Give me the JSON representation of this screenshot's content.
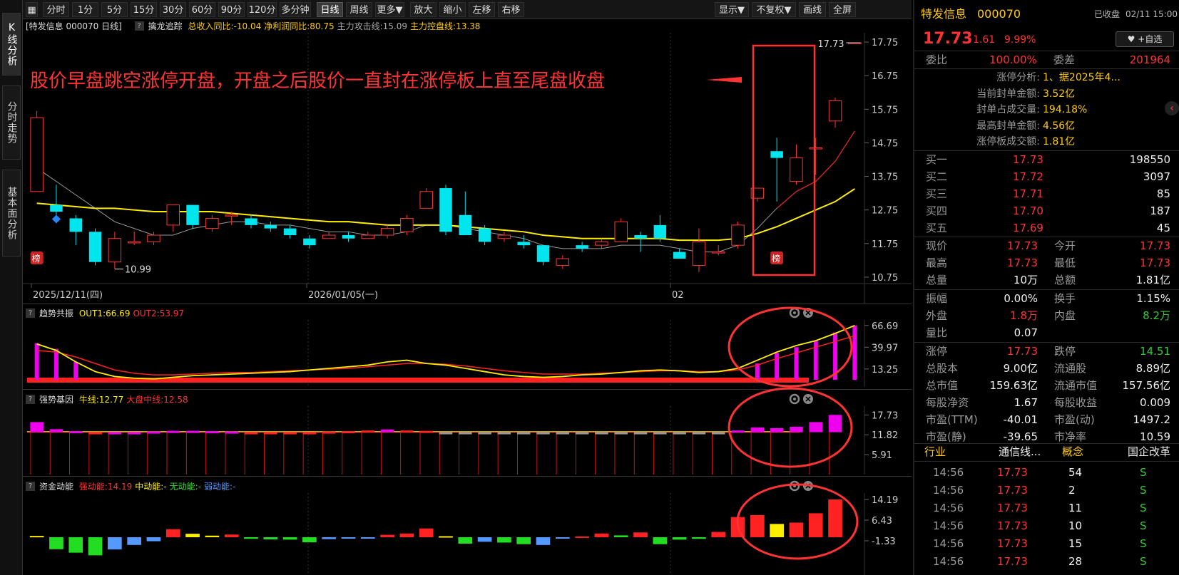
{
  "left_tabs": [
    "K线分析",
    "分时走势",
    "基本面分析"
  ],
  "toolbar": {
    "periods": [
      "分时",
      "1分",
      "5分",
      "15分",
      "30分",
      "60分",
      "90分",
      "120分",
      "多分钟",
      "日线",
      "周线",
      "更多▼",
      "放大",
      "缩小",
      "左移",
      "右移"
    ],
    "active_period": "日线",
    "right_buttons": [
      "显示▼",
      "不复权▼",
      "画线",
      "全屏"
    ]
  },
  "main_panel": {
    "header_title": "[特发信息 000070 日线]",
    "indicator_name": "擒龙追踪",
    "metrics": [
      {
        "label": "总收入同比:",
        "value": "-10.04",
        "color": "#ffcc00"
      },
      {
        "label": "净利润同比:",
        "value": "80.75",
        "color": "#ffcc00"
      },
      {
        "label": "主力攻击线:",
        "value": "15.09",
        "color": "#aaaaaa"
      },
      {
        "label": "主力控盘线:",
        "value": "13.38",
        "color": "#ffcc00"
      }
    ],
    "annotation": "股价早盘跳空涨停开盘，开盘之后股价一直封在涨停板上直至尾盘收盘",
    "y_ticks": [
      "17.75",
      "16.75",
      "15.75",
      "14.75",
      "13.75",
      "12.75",
      "11.75",
      "10.75"
    ],
    "high_label": "17.73",
    "low_label": "10.99",
    "rank_badge": "榜",
    "dates": [
      "2025/12/11(四)",
      "2026/01/05(一)",
      "02"
    ]
  },
  "panels": [
    {
      "name": "趋势共振",
      "metrics": [
        {
          "label": "OUT1:",
          "value": "66.69",
          "color": "#ffee00"
        },
        {
          "label": "OUT2:",
          "value": "53.97",
          "color": "#ff3333"
        }
      ],
      "y_ticks": [
        "66.69",
        "39.97",
        "13.25"
      ]
    },
    {
      "name": "强势基因",
      "metrics": [
        {
          "label": "牛线:",
          "value": "12.77",
          "color": "#ffee00"
        },
        {
          "label": "大盘中线:",
          "value": "12.58",
          "color": "#ff3333"
        }
      ],
      "y_ticks": [
        "17.73",
        "11.82",
        "5.91"
      ]
    },
    {
      "name": "资金动能",
      "metrics": [
        {
          "label": "强动能:",
          "value": "14.19",
          "color": "#ff3333"
        },
        {
          "label": "中动能:",
          "value": "-",
          "color": "#ffee00"
        },
        {
          "label": "无动能:",
          "value": "-",
          "color": "#33dd33"
        },
        {
          "label": "弱动能:",
          "value": "-",
          "color": "#5599ff"
        }
      ],
      "y_ticks": [
        "14.19",
        "6.43",
        "-1.33"
      ]
    }
  ],
  "chart_data": {
    "type": "candlestick",
    "y_range": [
      10.6,
      17.9
    ],
    "candles": [
      {
        "o": 13.3,
        "c": 15.5,
        "h": 15.7,
        "l": 13.3
      },
      {
        "o": 12.9,
        "c": 12.7,
        "h": 13.5,
        "l": 12.6
      },
      {
        "o": 12.5,
        "c": 12.1,
        "h": 12.6,
        "l": 11.7
      },
      {
        "o": 12.1,
        "c": 11.2,
        "h": 12.2,
        "l": 11.1
      },
      {
        "o": 11.2,
        "c": 11.9,
        "h": 12.1,
        "l": 10.99
      },
      {
        "o": 11.8,
        "c": 11.8,
        "h": 12.1,
        "l": 11.7
      },
      {
        "o": 11.8,
        "c": 12.0,
        "h": 12.1,
        "l": 11.7
      },
      {
        "o": 12.3,
        "c": 12.9,
        "h": 12.9,
        "l": 12.1
      },
      {
        "o": 12.9,
        "c": 12.3,
        "h": 12.9,
        "l": 12.2
      },
      {
        "o": 12.2,
        "c": 12.5,
        "h": 12.6,
        "l": 12.1
      },
      {
        "o": 12.6,
        "c": 12.6,
        "h": 12.7,
        "l": 12.3
      },
      {
        "o": 12.5,
        "c": 12.3,
        "h": 12.6,
        "l": 12.2
      },
      {
        "o": 12.3,
        "c": 12.2,
        "h": 12.4,
        "l": 12.1
      },
      {
        "o": 12.2,
        "c": 12.0,
        "h": 12.3,
        "l": 11.9
      },
      {
        "o": 11.9,
        "c": 11.7,
        "h": 12.0,
        "l": 11.6
      },
      {
        "o": 11.9,
        "c": 12.0,
        "h": 12.1,
        "l": 11.9
      },
      {
        "o": 12.0,
        "c": 11.9,
        "h": 12.1,
        "l": 11.8
      },
      {
        "o": 11.9,
        "c": 12.0,
        "h": 12.1,
        "l": 11.9
      },
      {
        "o": 12.0,
        "c": 12.2,
        "h": 12.3,
        "l": 11.9
      },
      {
        "o": 12.1,
        "c": 12.5,
        "h": 12.6,
        "l": 12.0
      },
      {
        "o": 12.8,
        "c": 13.3,
        "h": 13.4,
        "l": 12.8
      },
      {
        "o": 13.4,
        "c": 12.1,
        "h": 13.5,
        "l": 12.0
      },
      {
        "o": 12.6,
        "c": 12.0,
        "h": 13.3,
        "l": 12.0
      },
      {
        "o": 12.2,
        "c": 11.8,
        "h": 12.3,
        "l": 11.7
      },
      {
        "o": 11.9,
        "c": 12.0,
        "h": 12.1,
        "l": 11.8
      },
      {
        "o": 11.8,
        "c": 11.7,
        "h": 12.0,
        "l": 11.6
      },
      {
        "o": 11.7,
        "c": 11.2,
        "h": 11.7,
        "l": 11.1
      },
      {
        "o": 11.1,
        "c": 11.3,
        "h": 11.4,
        "l": 11.0
      },
      {
        "o": 11.7,
        "c": 11.6,
        "h": 11.8,
        "l": 11.5
      },
      {
        "o": 11.7,
        "c": 11.8,
        "h": 11.9,
        "l": 11.6
      },
      {
        "o": 11.8,
        "c": 12.4,
        "h": 12.5,
        "l": 11.8
      },
      {
        "o": 12.0,
        "c": 11.9,
        "h": 12.1,
        "l": 11.5
      },
      {
        "o": 12.3,
        "c": 11.9,
        "h": 12.6,
        "l": 11.8
      },
      {
        "o": 11.5,
        "c": 11.3,
        "h": 11.6,
        "l": 11.3
      },
      {
        "o": 11.1,
        "c": 11.8,
        "h": 12.2,
        "l": 10.9
      },
      {
        "o": 11.5,
        "c": 11.5,
        "h": 11.7,
        "l": 11.4
      },
      {
        "o": 11.7,
        "c": 12.3,
        "h": 12.4,
        "l": 11.6
      },
      {
        "o": 13.1,
        "c": 13.4,
        "h": 13.4,
        "l": 13.0
      },
      {
        "o": 14.5,
        "c": 14.3,
        "h": 14.9,
        "l": 13.0
      },
      {
        "o": 13.6,
        "c": 14.3,
        "h": 14.7,
        "l": 13.5
      },
      {
        "o": 14.6,
        "c": 14.6,
        "h": 14.9,
        "l": 13.8
      },
      {
        "o": 15.4,
        "c": 16.0,
        "h": 16.1,
        "l": 15.2
      },
      {
        "o": 17.73,
        "c": 17.73,
        "h": 17.73,
        "l": 17.73
      }
    ],
    "ma_gray": [
      14.0,
      13.6,
      13.2,
      12.8,
      12.4,
      12.2,
      12.0,
      12.0,
      12.2,
      12.3,
      12.4,
      12.4,
      12.3,
      12.3,
      12.2,
      12.1,
      12.1,
      12.0,
      12.0,
      12.1,
      12.3,
      12.3,
      12.2,
      12.1,
      12.0,
      11.9,
      11.7,
      11.6,
      11.6,
      11.6,
      11.7,
      11.7,
      11.7,
      11.6,
      11.5,
      11.5,
      11.7,
      12.2,
      12.8,
      13.3,
      13.6,
      14.2,
      15.1
    ],
    "ma_yellow": [
      12.95,
      12.9,
      12.85,
      12.8,
      12.8,
      12.75,
      12.7,
      12.7,
      12.7,
      12.7,
      12.65,
      12.6,
      12.55,
      12.5,
      12.45,
      12.4,
      12.4,
      12.35,
      12.3,
      12.3,
      12.3,
      12.3,
      12.25,
      12.2,
      12.15,
      12.1,
      12.0,
      11.95,
      11.9,
      11.9,
      11.9,
      11.9,
      11.9,
      11.85,
      11.85,
      11.85,
      11.9,
      12.05,
      12.25,
      12.5,
      12.75,
      13.0,
      13.38
    ],
    "trend_bars": [
      45,
      38,
      22,
      0,
      0,
      0,
      0,
      0,
      0,
      0,
      0,
      0,
      0,
      0,
      0,
      0,
      0,
      0,
      0,
      0,
      0,
      0,
      0,
      0,
      0,
      0,
      0,
      0,
      0,
      0,
      0,
      0,
      0,
      0,
      0,
      0,
      0,
      20,
      33,
      40,
      48,
      58,
      66.69
    ],
    "trend_out1": [
      44,
      36,
      22,
      10,
      4,
      2,
      1,
      3,
      5,
      6,
      7,
      8,
      9,
      10,
      12,
      14,
      16,
      18,
      22,
      24,
      20,
      18,
      14,
      10,
      6,
      4,
      3,
      4,
      6,
      7,
      9,
      11,
      12,
      11,
      9,
      10,
      14,
      24,
      34,
      42,
      48,
      57,
      66.69
    ],
    "trend_out2": [
      36,
      34,
      28,
      20,
      12,
      8,
      6,
      6,
      7,
      8,
      9,
      9,
      10,
      11,
      12,
      13,
      14,
      16,
      18,
      20,
      20,
      19,
      17,
      14,
      11,
      9,
      7,
      7,
      7,
      8,
      9,
      10,
      11,
      11,
      10,
      10,
      12,
      18,
      26,
      33,
      40,
      47,
      53.97
    ],
    "gene_bars": [
      {
        "v": 15.6,
        "c": "#ee00ee"
      },
      {
        "v": 13.5,
        "c": "#ee00ee"
      },
      {
        "v": 12.9,
        "c": "#ee00ee"
      },
      {
        "v": 12.3,
        "c": "#ff2222"
      },
      {
        "v": 12.4,
        "c": "#ee00ee"
      },
      {
        "v": 12.6,
        "c": "#ee00ee"
      },
      {
        "v": 12.8,
        "c": "#ee00ee"
      },
      {
        "v": 13.0,
        "c": "#ee00ee"
      },
      {
        "v": 13.0,
        "c": "#ee00ee"
      },
      {
        "v": 12.9,
        "c": "#ee00ee"
      },
      {
        "v": 12.8,
        "c": "#ee00ee"
      },
      {
        "v": 12.6,
        "c": "#ff2222"
      },
      {
        "v": 12.5,
        "c": "#ff2222"
      },
      {
        "v": 12.4,
        "c": "#ff2222"
      },
      {
        "v": 12.6,
        "c": "#ff2222"
      },
      {
        "v": 12.8,
        "c": "#ff2222"
      },
      {
        "v": 12.9,
        "c": "#ff2222"
      },
      {
        "v": 13.1,
        "c": "#ff2222"
      },
      {
        "v": 13.4,
        "c": "#ee00ee"
      },
      {
        "v": 13.1,
        "c": "#ff2222"
      },
      {
        "v": 13.0,
        "c": "#ff2222"
      },
      {
        "v": 12.5,
        "c": "#999999"
      },
      {
        "v": 12.4,
        "c": "#999999"
      },
      {
        "v": 12.3,
        "c": "#999999"
      },
      {
        "v": 12.3,
        "c": "#999999"
      },
      {
        "v": 12.2,
        "c": "#999999"
      },
      {
        "v": 12.2,
        "c": "#999999"
      },
      {
        "v": 12.1,
        "c": "#999999"
      },
      {
        "v": 12.2,
        "c": "#999999"
      },
      {
        "v": 12.3,
        "c": "#999999"
      },
      {
        "v": 12.3,
        "c": "#999999"
      },
      {
        "v": 12.2,
        "c": "#999999"
      },
      {
        "v": 12.1,
        "c": "#999999"
      },
      {
        "v": 12.2,
        "c": "#999999"
      },
      {
        "v": 12.3,
        "c": "#999999"
      },
      {
        "v": 12.4,
        "c": "#999999"
      },
      {
        "v": 13.1,
        "c": "#ee00ee"
      },
      {
        "v": 14.0,
        "c": "#ee00ee"
      },
      {
        "v": 13.8,
        "c": "#ee00ee"
      },
      {
        "v": 14.2,
        "c": "#ee00ee"
      },
      {
        "v": 15.6,
        "c": "#ee00ee"
      },
      {
        "v": 17.73,
        "c": "#ee00ee"
      }
    ],
    "fund_bars": [
      {
        "v": 0.5,
        "c": "#ffee00"
      },
      {
        "v": -4.5,
        "c": "#22dd22"
      },
      {
        "v": -5.8,
        "c": "#22dd22"
      },
      {
        "v": -6.8,
        "c": "#22dd22"
      },
      {
        "v": -4.6,
        "c": "#5599ff"
      },
      {
        "v": -2.9,
        "c": "#5599ff"
      },
      {
        "v": -1.5,
        "c": "#5599ff"
      },
      {
        "v": 3.0,
        "c": "#ff2222"
      },
      {
        "v": 1.3,
        "c": "#ffee00"
      },
      {
        "v": 0.6,
        "c": "#ffee00"
      },
      {
        "v": 1.0,
        "c": "#ff2222"
      },
      {
        "v": -0.6,
        "c": "#22dd22"
      },
      {
        "v": -0.8,
        "c": "#22dd22"
      },
      {
        "v": -0.9,
        "c": "#22dd22"
      },
      {
        "v": -1.9,
        "c": "#22dd22"
      },
      {
        "v": -0.7,
        "c": "#5599ff"
      },
      {
        "v": -0.5,
        "c": "#5599ff"
      },
      {
        "v": -0.4,
        "c": "#5599ff"
      },
      {
        "v": 0.9,
        "c": "#ff2222"
      },
      {
        "v": 1.4,
        "c": "#ff2222"
      },
      {
        "v": 3.3,
        "c": "#ff2222"
      },
      {
        "v": 0.4,
        "c": "#ffee00"
      },
      {
        "v": -2.4,
        "c": "#22dd22"
      },
      {
        "v": -1.7,
        "c": "#5599ff"
      },
      {
        "v": -2.0,
        "c": "#22dd22"
      },
      {
        "v": -2.6,
        "c": "#22dd22"
      },
      {
        "v": -2.9,
        "c": "#5599ff"
      },
      {
        "v": -0.4,
        "c": "#5599ff"
      },
      {
        "v": 0.3,
        "c": "#ff2222"
      },
      {
        "v": 1.4,
        "c": "#ff2222"
      },
      {
        "v": 0.7,
        "c": "#22dd22"
      },
      {
        "v": 1.8,
        "c": "#ff2222"
      },
      {
        "v": -2.6,
        "c": "#22dd22"
      },
      {
        "v": -0.9,
        "c": "#22dd22"
      },
      {
        "v": -0.6,
        "c": "#22dd22"
      },
      {
        "v": 2.0,
        "c": "#ff2222"
      },
      {
        "v": 7.6,
        "c": "#ff2222"
      },
      {
        "v": 8.3,
        "c": "#ff2222"
      },
      {
        "v": 5.0,
        "c": "#ffee00"
      },
      {
        "v": 5.5,
        "c": "#ff2222"
      },
      {
        "v": 9.0,
        "c": "#ff2222"
      },
      {
        "v": 14.19,
        "c": "#ff2222"
      }
    ]
  },
  "quote": {
    "name": "特发信息",
    "code": "000070",
    "status": "已收盘",
    "datetime": "02/11 15:00",
    "price": "17.73",
    "change": "1.61",
    "change_pct": "9.99%",
    "watch_button": "+自选",
    "weibi_label": "委比",
    "weibi": "100.00%",
    "weicha_label": "委差",
    "weicha": "201964",
    "limit_analysis": [
      {
        "label": "涨停分析:",
        "value": "1、据2025年4..."
      },
      {
        "label": "当前封单金额:",
        "value": "3.52亿"
      },
      {
        "label": "封单占成交量:",
        "value": "194.18%"
      },
      {
        "label": "最高封单金额:",
        "value": "4.56亿"
      },
      {
        "label": "涨停板成交额:",
        "value": "1.81亿"
      }
    ],
    "buys": [
      {
        "label": "买一",
        "price": "17.73",
        "vol": "198550"
      },
      {
        "label": "买二",
        "price": "17.72",
        "vol": "3097"
      },
      {
        "label": "买三",
        "price": "17.71",
        "vol": "85"
      },
      {
        "label": "买四",
        "price": "17.70",
        "vol": "187"
      },
      {
        "label": "买五",
        "price": "17.69",
        "vol": "45"
      }
    ],
    "stats": [
      [
        {
          "label": "现价",
          "value": "17.73",
          "cls": "red"
        },
        {
          "label": "今开",
          "value": "17.73",
          "cls": "red"
        }
      ],
      [
        {
          "label": "最高",
          "value": "17.73",
          "cls": "red"
        },
        {
          "label": "最低",
          "value": "17.73",
          "cls": "red"
        }
      ],
      [
        {
          "label": "总量",
          "value": "10万",
          "cls": "white"
        },
        {
          "label": "总额",
          "value": "1.81亿",
          "cls": "white"
        }
      ],
      [
        {
          "label": "振幅",
          "value": "0.00%",
          "cls": "white"
        },
        {
          "label": "换手",
          "value": "1.15%",
          "cls": "white"
        }
      ],
      [
        {
          "label": "外盘",
          "value": "1.8万",
          "cls": "red"
        },
        {
          "label": "内盘",
          "value": "8.2万",
          "cls": "green"
        }
      ],
      [
        {
          "label": "量比",
          "value": "0.07",
          "cls": "white"
        },
        {
          "label": "",
          "value": "",
          "cls": "white"
        }
      ],
      [
        {
          "label": "涨停",
          "value": "17.73",
          "cls": "red"
        },
        {
          "label": "跌停",
          "value": "14.51",
          "cls": "green"
        }
      ],
      [
        {
          "label": "总股本",
          "value": "9.00亿",
          "cls": "white"
        },
        {
          "label": "流通股",
          "value": "8.89亿",
          "cls": "white"
        }
      ],
      [
        {
          "label": "总市值",
          "value": "159.63亿",
          "cls": "white"
        },
        {
          "label": "流通市值",
          "value": "157.56亿",
          "cls": "white"
        }
      ],
      [
        {
          "label": "每股净资",
          "value": "1.67",
          "cls": "white"
        },
        {
          "label": "每股收益",
          "value": "0.009",
          "cls": "white"
        }
      ],
      [
        {
          "label": "市盈(TTM)",
          "value": "-40.01",
          "cls": "white"
        },
        {
          "label": "市盈(动)",
          "value": "1497.2",
          "cls": "white"
        }
      ],
      [
        {
          "label": "市盈(静)",
          "value": "-39.65",
          "cls": "white"
        },
        {
          "label": "市净率",
          "value": "10.59",
          "cls": "white"
        }
      ]
    ],
    "industry_label": "行业",
    "industry": "通信线...",
    "concept_label": "概念",
    "concept": "国企改革",
    "ticks": [
      {
        "time": "14:56",
        "price": "17.73",
        "vol": "54",
        "side": "S"
      },
      {
        "time": "14:56",
        "price": "17.73",
        "vol": "2",
        "side": "S"
      },
      {
        "time": "14:56",
        "price": "17.73",
        "vol": "11",
        "side": "S"
      },
      {
        "time": "14:56",
        "price": "17.73",
        "vol": "10",
        "side": "S"
      },
      {
        "time": "14:56",
        "price": "17.73",
        "vol": "15",
        "side": "S"
      },
      {
        "time": "14:56",
        "price": "17.73",
        "vol": "28",
        "side": "S"
      }
    ],
    "colors": {
      "up": "#ff3333",
      "down": "#00e5ee",
      "accent": "#ffcc00"
    }
  }
}
